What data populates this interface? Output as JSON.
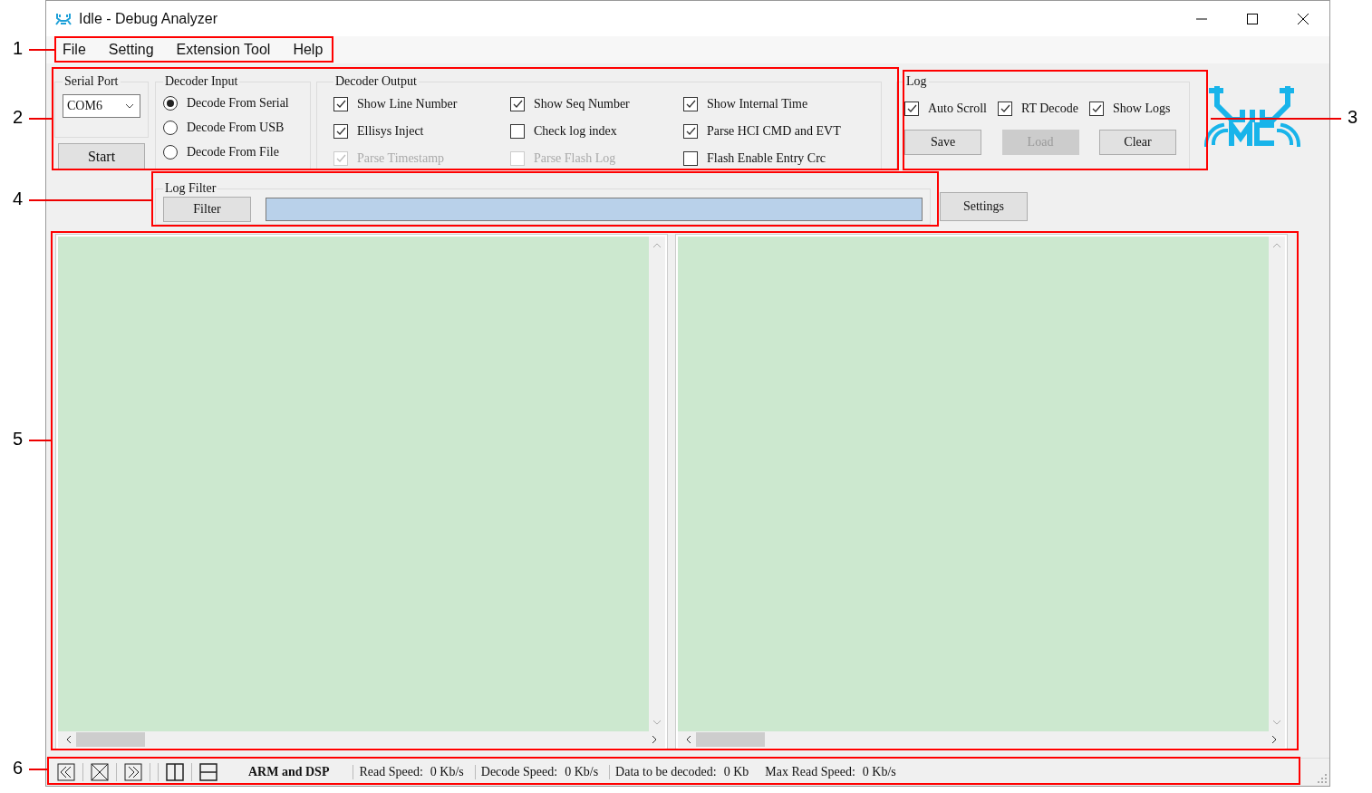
{
  "window": {
    "title": "Idle - Debug Analyzer"
  },
  "menu": [
    "File",
    "Setting",
    "Extension Tool",
    "Help"
  ],
  "serial_port": {
    "label": "Serial Port",
    "value": "COM6"
  },
  "start_button": "Start",
  "decoder_input": {
    "label": "Decoder Input",
    "options": [
      {
        "label": "Decode From Serial",
        "selected": true
      },
      {
        "label": "Decode From USB",
        "selected": false
      },
      {
        "label": "Decode From File",
        "selected": false
      }
    ]
  },
  "decoder_output": {
    "label": "Decoder Output",
    "options": [
      {
        "label": "Show Line Number",
        "checked": true,
        "disabled": false
      },
      {
        "label": "Ellisys Inject",
        "checked": true,
        "disabled": false
      },
      {
        "label": "Parse Timestamp",
        "checked": true,
        "disabled": true
      },
      {
        "label": "Show Seq Number",
        "checked": true,
        "disabled": false
      },
      {
        "label": "Check log index",
        "checked": false,
        "disabled": false
      },
      {
        "label": "Parse Flash Log",
        "checked": false,
        "disabled": true
      },
      {
        "label": "Show Internal Time",
        "checked": true,
        "disabled": false
      },
      {
        "label": "Parse HCI CMD and EVT",
        "checked": true,
        "disabled": false
      },
      {
        "label": "Flash Enable Entry Crc",
        "checked": false,
        "disabled": false
      }
    ]
  },
  "log": {
    "label": "Log",
    "options": [
      {
        "label": "Auto Scroll",
        "checked": true
      },
      {
        "label": "RT Decode",
        "checked": true
      },
      {
        "label": "Show Logs",
        "checked": true
      }
    ],
    "buttons": [
      {
        "label": "Save",
        "disabled": false
      },
      {
        "label": "Load",
        "disabled": true
      },
      {
        "label": "Clear",
        "disabled": false
      }
    ]
  },
  "log_filter": {
    "label": "Log Filter",
    "button": "Filter"
  },
  "settings_button": "Settings",
  "status_bar": {
    "mode": "ARM and DSP",
    "items": [
      {
        "label": "Read Speed:",
        "value": "0 Kb/s",
        "divider": true
      },
      {
        "label": "Decode Speed:",
        "value": "0 Kb/s",
        "divider": true
      },
      {
        "label": "Data to be decoded:",
        "value": "0 Kb",
        "divider": true
      },
      {
        "label": "Max Read Speed:",
        "value": "0 Kb/s",
        "divider": false
      }
    ]
  },
  "annotations": [
    "1",
    "2",
    "3",
    "4",
    "5",
    "6"
  ]
}
